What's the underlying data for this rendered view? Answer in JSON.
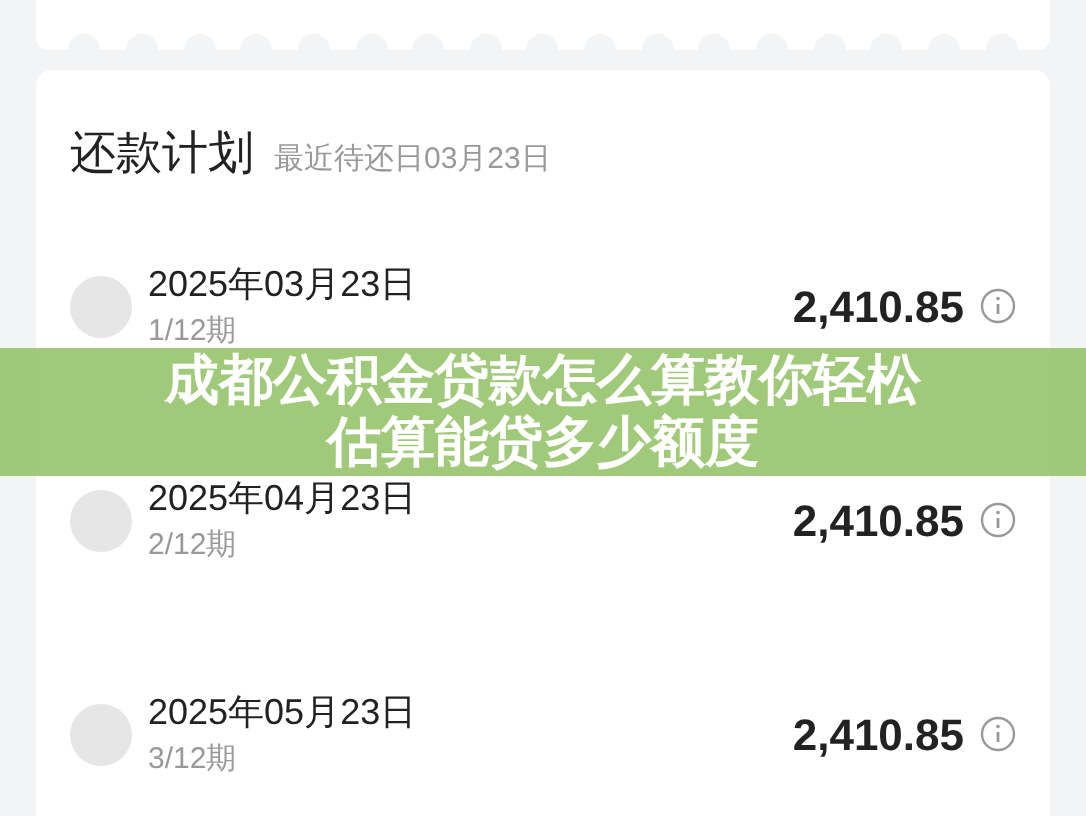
{
  "plan": {
    "title": "还款计划",
    "subtitle": "最近待还日03月23日",
    "rows": [
      {
        "date": "2025年03月23日",
        "term": "1/12期",
        "amount": "2,410.85"
      },
      {
        "date": "2025年04月23日",
        "term": "2/12期",
        "amount": "2,410.85"
      },
      {
        "date": "2025年05月23日",
        "term": "3/12期",
        "amount": "2,410.85"
      }
    ]
  },
  "banner": {
    "text": "成都公积金贷款怎么算教你轻松估算能贷多少额度"
  }
}
